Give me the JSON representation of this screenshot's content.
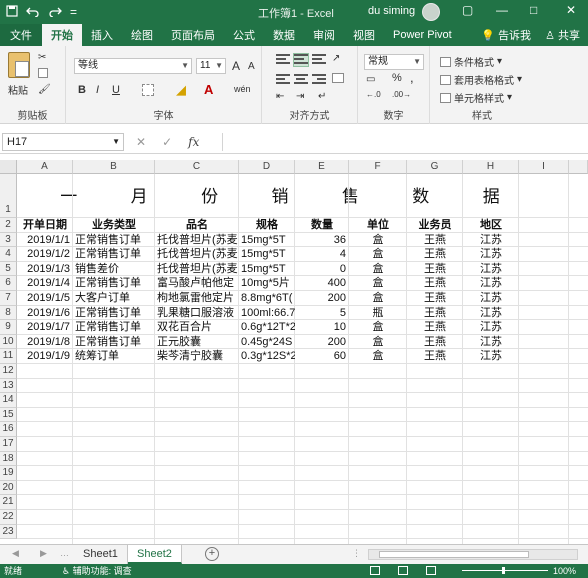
{
  "titlebar": {
    "doc_title": "工作簿1 - Excel",
    "user": "du siming",
    "qat_save_icon": "save-icon",
    "qat_undo_icon": "undo-icon",
    "qat_redo_icon": "redo-icon",
    "qat_more": "=",
    "win_restore": "▢",
    "win_minimize": "—",
    "win_maximize": "□",
    "win_close": "✕"
  },
  "tabs": [
    "文件",
    "开始",
    "插入",
    "绘图",
    "页面布局",
    "公式",
    "数据",
    "审阅",
    "视图",
    "Power Pivot"
  ],
  "tabs_right": {
    "tell_me": "告诉我",
    "share": "共享"
  },
  "ribbon": {
    "clipboard": {
      "label": "剪贴板",
      "paste": "粘贴"
    },
    "font": {
      "label": "字体",
      "font_name": "等线",
      "font_size": "11",
      "grow": "A",
      "shrink": "A",
      "bold": "B",
      "italic": "I",
      "underline": "U",
      "wen": "wén"
    },
    "alignment": {
      "label": "对齐方式"
    },
    "number": {
      "label": "数字",
      "format": "常规",
      "percent": "%",
      "comma": ","
    },
    "styles": {
      "label": "样式",
      "conditional": "条件格式",
      "table": "套用表格格式",
      "cell": "单元格样式"
    }
  },
  "formula_bar": {
    "name_box": "H17",
    "cancel": "✕",
    "enter": "✓",
    "fx": "fx",
    "value": ""
  },
  "columns": [
    "A",
    "B",
    "C",
    "D",
    "E",
    "F",
    "G",
    "H",
    "I"
  ],
  "rows": [
    "1",
    "2",
    "3",
    "4",
    "5",
    "6",
    "7",
    "8",
    "9",
    "10",
    "11",
    "12",
    "13",
    "14",
    "15",
    "16",
    "17",
    "18",
    "19",
    "20",
    "21",
    "22",
    "23"
  ],
  "sheet": {
    "title": "一 月 份 销 售 数 据",
    "headers": [
      "开单日期",
      "业务类型",
      "品名",
      "规格",
      "数量",
      "单位",
      "业务员",
      "地区"
    ],
    "data": [
      [
        "2019/1/1",
        "正常销售订单",
        "托伐普坦片(苏麦",
        "15mg*5T",
        "36",
        "盒",
        "王燕",
        "江苏"
      ],
      [
        "2019/1/2",
        "正常销售订单",
        "托伐普坦片(苏麦",
        "15mg*5T",
        "4",
        "盒",
        "王燕",
        "江苏"
      ],
      [
        "2019/1/3",
        "销售差价",
        "托伐普坦片(苏麦",
        "15mg*5T",
        "0",
        "盒",
        "王燕",
        "江苏"
      ],
      [
        "2019/1/4",
        "正常销售订单",
        "富马酸卢帕他定",
        "10mg*5片",
        "400",
        "盒",
        "王燕",
        "江苏"
      ],
      [
        "2019/1/5",
        "大客户订单",
        "枸地氯雷他定片",
        "8.8mg*6T(",
        "200",
        "盒",
        "王燕",
        "江苏"
      ],
      [
        "2019/1/6",
        "正常销售订单",
        "乳果糖口服溶液",
        "100ml:66.7",
        "5",
        "瓶",
        "王燕",
        "江苏"
      ],
      [
        "2019/1/7",
        "正常销售订单",
        "双花百合片",
        "0.6g*12T*2",
        "10",
        "盒",
        "王燕",
        "江苏"
      ],
      [
        "2019/1/8",
        "正常销售订单",
        "正元胶囊",
        "0.45g*24S",
        "200",
        "盒",
        "王燕",
        "江苏"
      ],
      [
        "2019/1/9",
        "统筹订单",
        "柴芩清宁胶囊",
        "0.3g*12S*2",
        "60",
        "盒",
        "王燕",
        "江苏"
      ]
    ]
  },
  "sheet_tabs": [
    "Sheet1",
    "Sheet2"
  ],
  "active_sheet": "Sheet2",
  "status": {
    "ready": "就绪",
    "accessibility": "辅助功能: 调查",
    "zoom": "100%"
  },
  "colors": {
    "excel_green": "#217346",
    "ribbon_bg": "#f3f3f3"
  }
}
